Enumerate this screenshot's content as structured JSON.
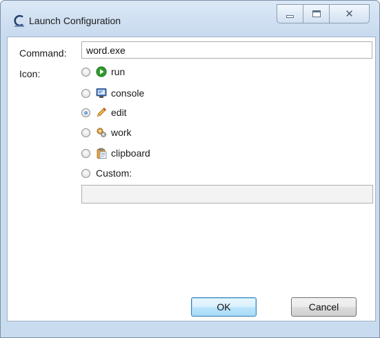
{
  "window": {
    "title": "Launch Configuration",
    "app_icon": "eclipse-c-icon",
    "controls": [
      "minimize",
      "maximize",
      "close"
    ]
  },
  "form": {
    "command_label": "Command:",
    "command_value": "word.exe",
    "icon_label": "Icon:",
    "options": [
      {
        "label": "run",
        "icon": "run-icon",
        "checked": false
      },
      {
        "label": "console",
        "icon": "console-icon",
        "checked": false
      },
      {
        "label": "edit",
        "icon": "edit-pencil-icon",
        "checked": true
      },
      {
        "label": "work",
        "icon": "gears-icon",
        "checked": false
      },
      {
        "label": "clipboard",
        "icon": "clipboard-icon",
        "checked": false
      },
      {
        "label": "Custom:",
        "icon": "",
        "checked": false
      }
    ],
    "custom_value": ""
  },
  "buttons": {
    "ok": "OK",
    "cancel": "Cancel"
  },
  "colors": {
    "frame": "#c9dbef",
    "radio_selected": "#1e5fb0"
  }
}
